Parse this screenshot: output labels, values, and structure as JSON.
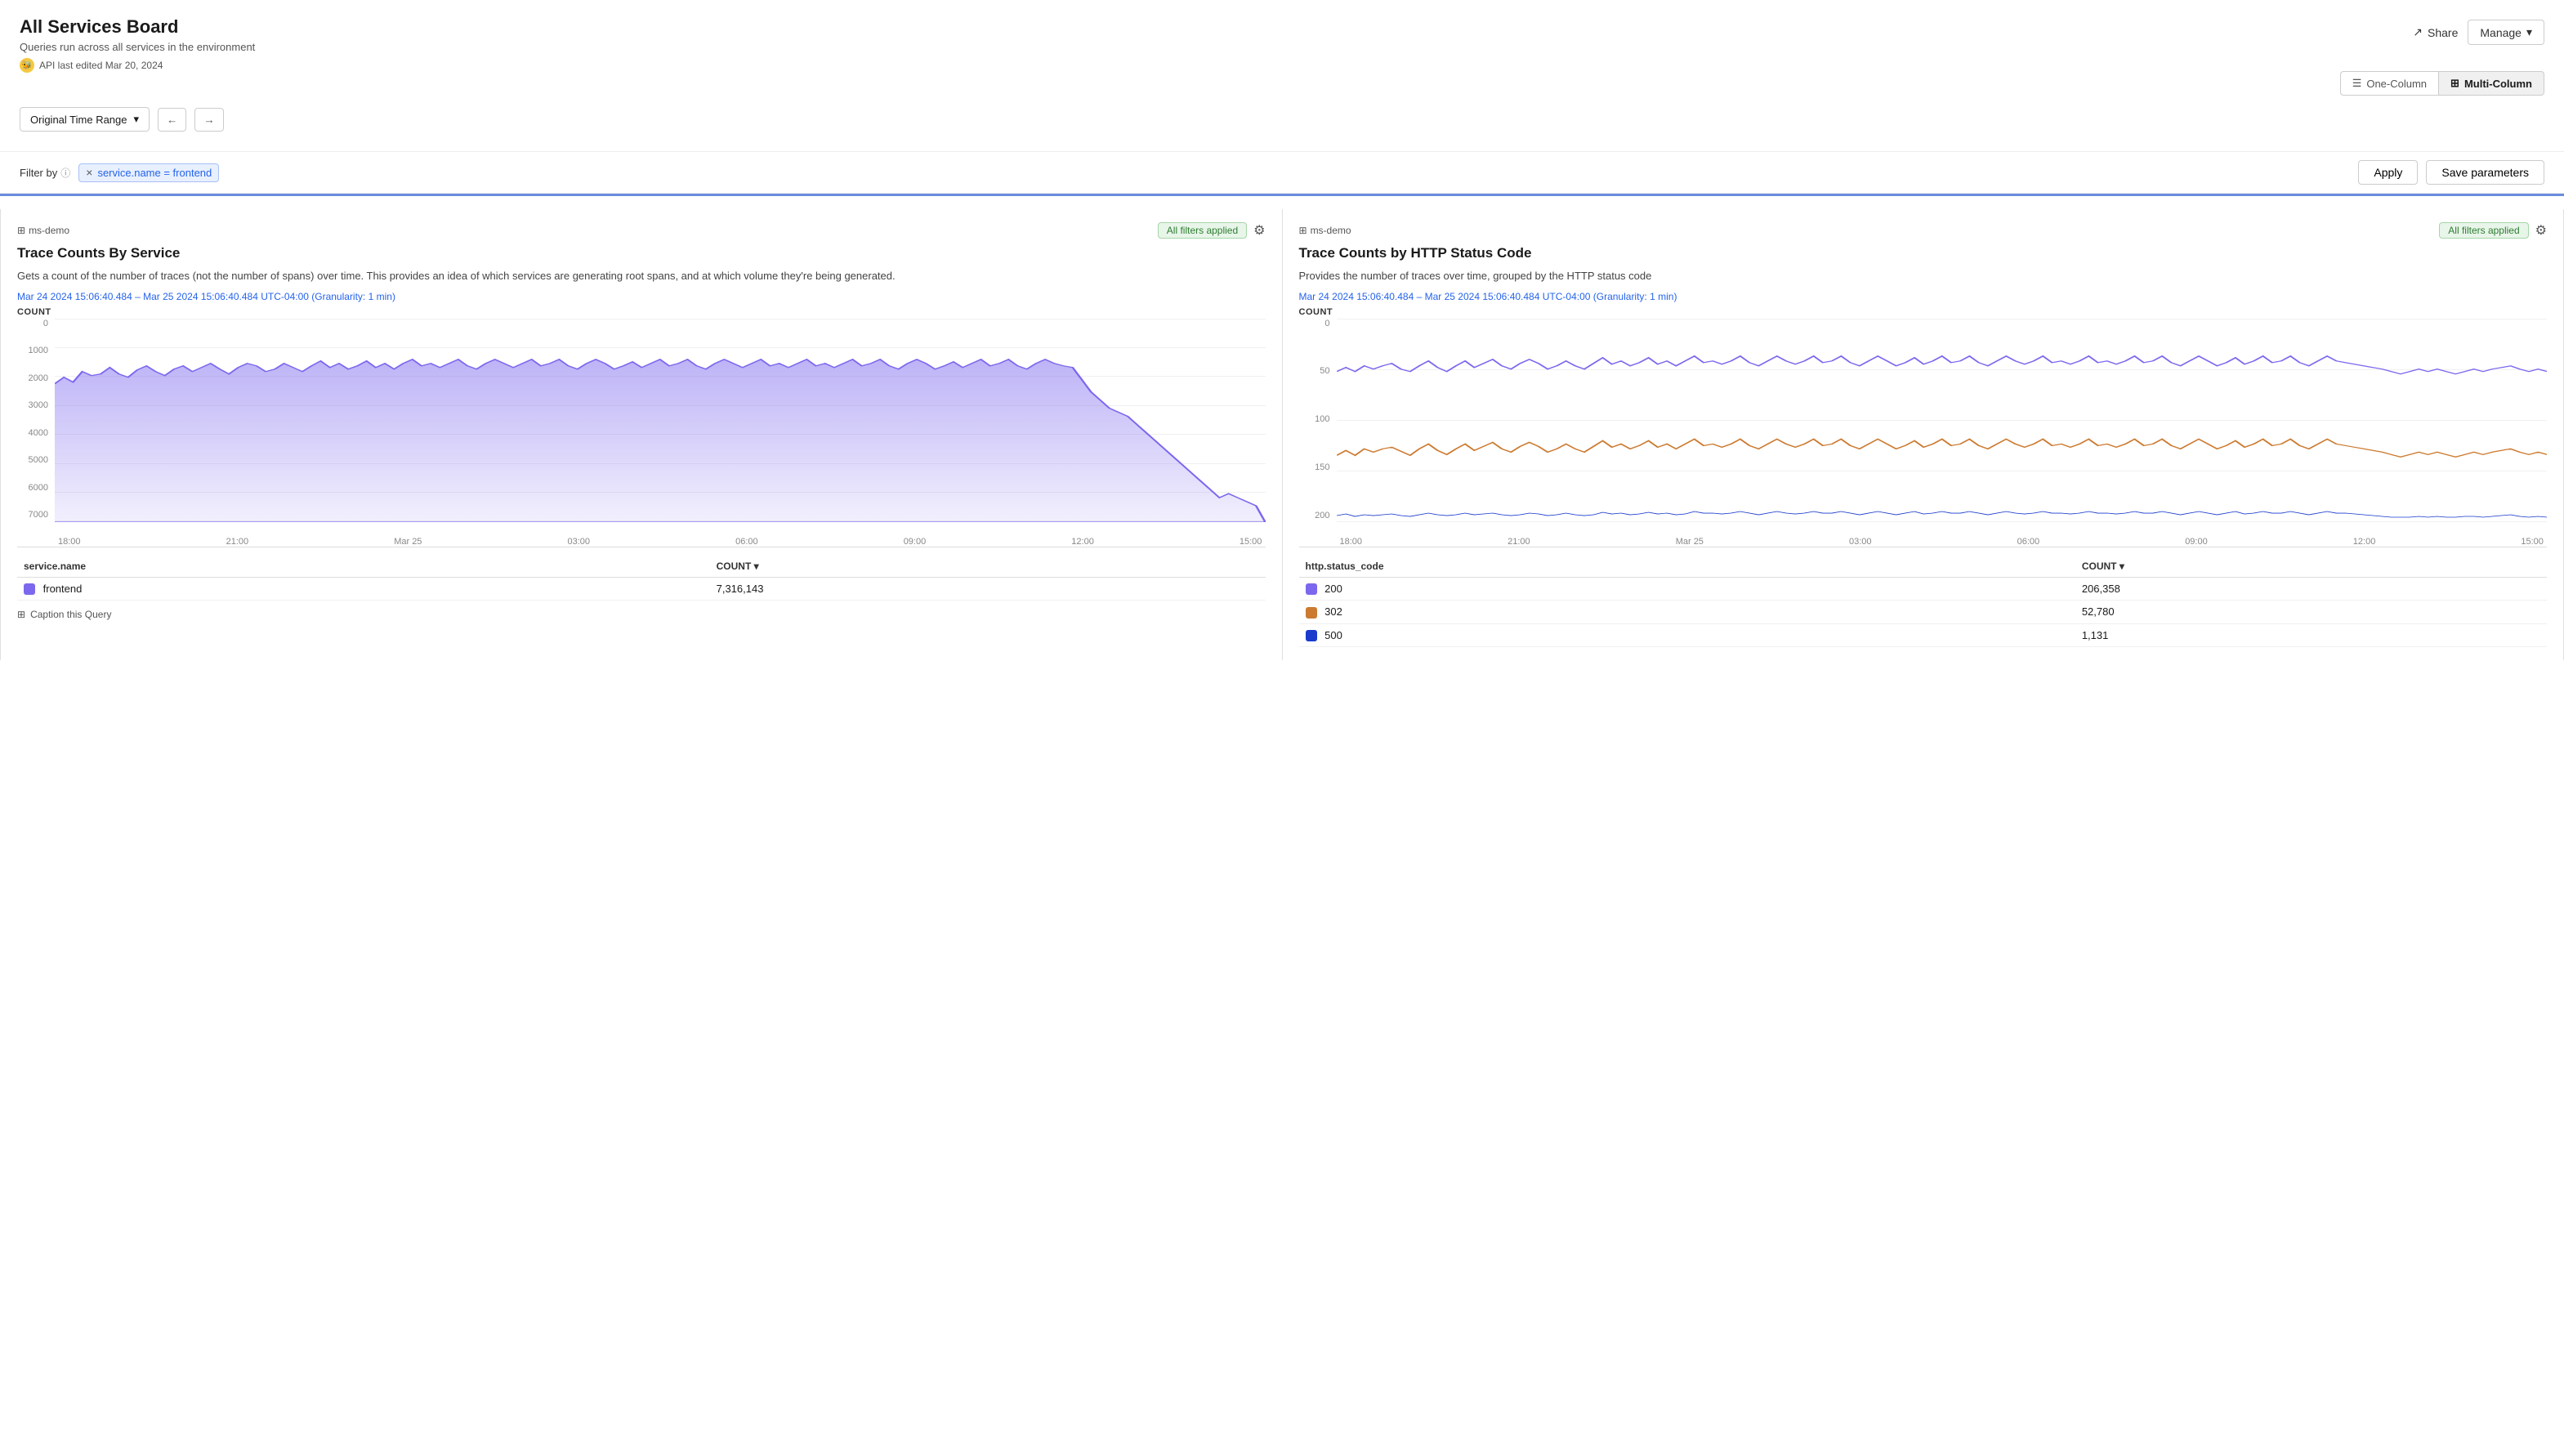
{
  "page": {
    "title": "All Services Board",
    "subtitle": "Queries run across all services in the environment",
    "api_edited": "API last edited Mar 20, 2024"
  },
  "header_actions": {
    "share_label": "Share",
    "manage_label": "Manage"
  },
  "layout": {
    "one_column_label": "One-Column",
    "multi_column_label": "Multi-Column"
  },
  "toolbar": {
    "time_range_label": "Original Time Range"
  },
  "filter_bar": {
    "filter_label": "Filter by",
    "chip_value": "service.name = frontend",
    "apply_label": "Apply",
    "save_params_label": "Save parameters"
  },
  "panel_left": {
    "source": "ms-demo",
    "all_filters_label": "All filters applied",
    "title": "Trace Counts By Service",
    "description": "Gets a count of the number of traces (not the number of spans) over time. This provides an idea of which services are generating root spans, and at which volume they're being generated.",
    "time_range": "Mar 24 2024 15:06:40.484 – Mar 25 2024 15:06:40.484 UTC-04:00 (Granularity: 1 min)",
    "count_label": "COUNT",
    "y_labels": [
      "0",
      "1000",
      "2000",
      "3000",
      "4000",
      "5000",
      "6000",
      "7000"
    ],
    "x_labels": [
      "18:00",
      "21:00",
      "Mar 25",
      "03:00",
      "06:00",
      "09:00",
      "12:00",
      "15:00"
    ],
    "table": {
      "col1": "service.name",
      "col2": "COUNT",
      "rows": [
        {
          "color": "#7b68ee",
          "name": "frontend",
          "count": "7,316,143"
        }
      ]
    },
    "caption_label": "Caption this Query"
  },
  "panel_right": {
    "source": "ms-demo",
    "all_filters_label": "All filters applied",
    "title": "Trace Counts by HTTP Status Code",
    "description": "Provides the number of traces over time, grouped by the HTTP status code",
    "time_range": "Mar 24 2024 15:06:40.484 – Mar 25 2024 15:06:40.484 UTC-04:00 (Granularity: 1 min)",
    "count_label": "COUNT",
    "y_labels": [
      "0",
      "50",
      "100",
      "150",
      "200"
    ],
    "x_labels": [
      "18:00",
      "21:00",
      "Mar 25",
      "03:00",
      "06:00",
      "09:00",
      "12:00",
      "15:00"
    ],
    "table": {
      "col1": "http.status_code",
      "col2": "COUNT",
      "rows": [
        {
          "color": "#7b68ee",
          "code": "200",
          "count": "206,358"
        },
        {
          "color": "#cc7a30",
          "code": "302",
          "count": "52,780"
        },
        {
          "color": "#1a3bcc",
          "code": "500",
          "count": "1,131"
        }
      ]
    }
  }
}
